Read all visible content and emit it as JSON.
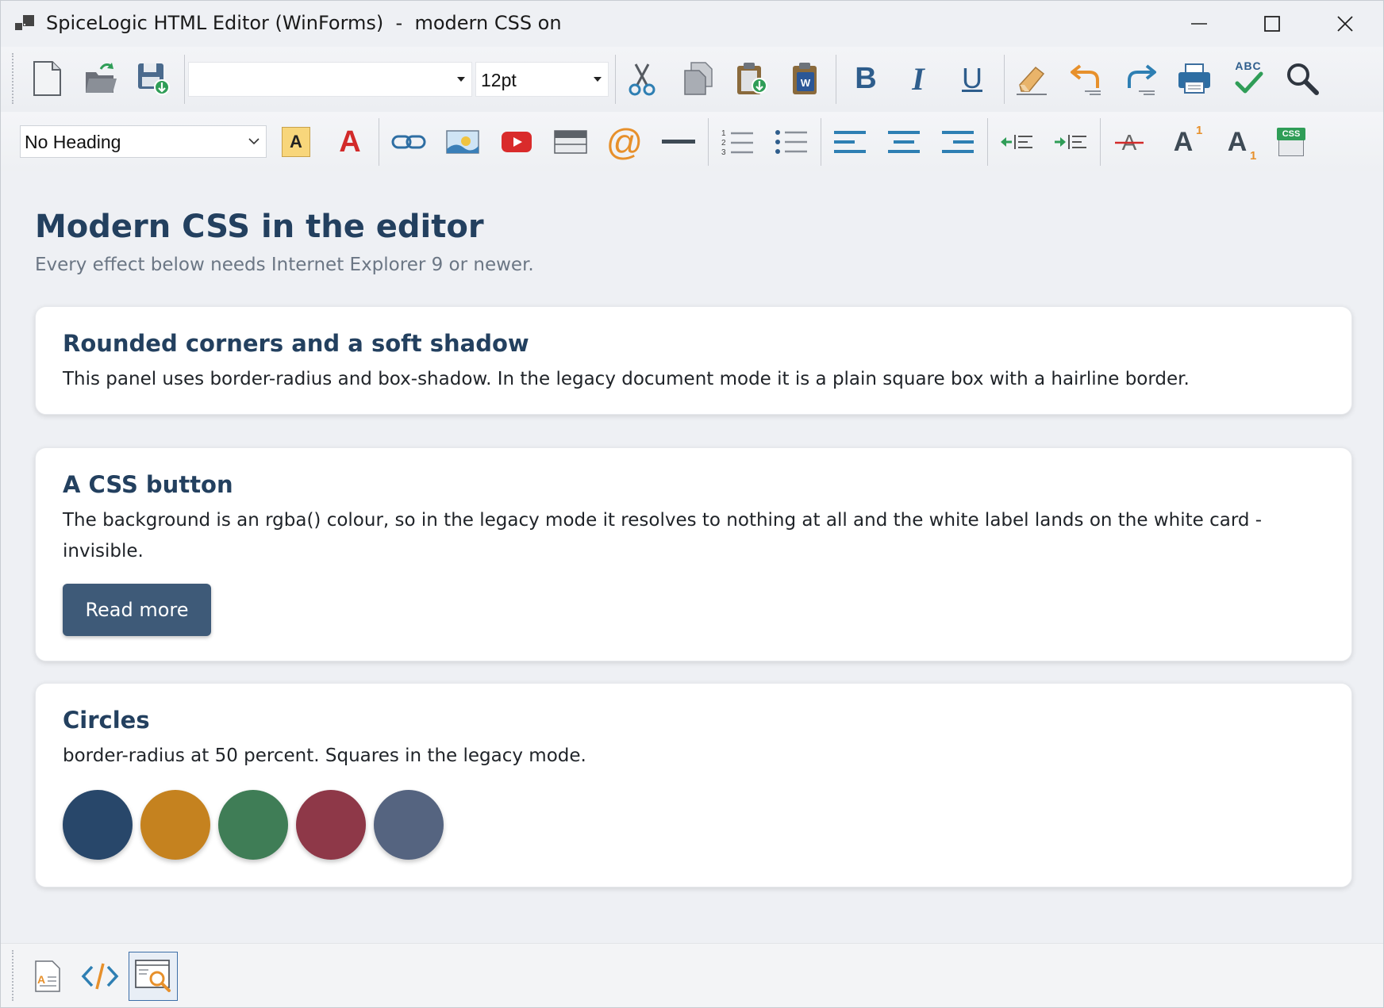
{
  "window": {
    "title": "SpiceLogic HTML Editor (WinForms)  -  modern CSS on",
    "controls": [
      "minimize-icon",
      "maximize-icon",
      "close-icon"
    ]
  },
  "toolbar1": {
    "font_name": "",
    "font_size": "12pt",
    "icons": [
      "new-document-icon",
      "open-folder-icon",
      "save-icon",
      "cut-icon",
      "copy-icon",
      "paste-icon",
      "paste-from-word-icon",
      "bold-icon",
      "italic-icon",
      "underline-icon",
      "clear-format-icon",
      "undo-icon",
      "redo-icon",
      "print-icon",
      "spell-check-icon",
      "find-icon"
    ],
    "bold_glyph": "B",
    "italic_glyph": "I",
    "underline_glyph": "U",
    "spellcheck_glyph": "ABC"
  },
  "toolbar2": {
    "heading_value": "No Heading",
    "icons": [
      "highlight-color-icon",
      "font-color-icon",
      "hyperlink-icon",
      "insert-image-icon",
      "insert-youtube-icon",
      "insert-table-icon",
      "insert-email-icon",
      "horizontal-rule-icon",
      "ordered-list-icon",
      "unordered-list-icon",
      "align-left-icon",
      "align-center-icon",
      "align-right-icon",
      "outdent-icon",
      "indent-icon",
      "strikethrough-icon",
      "superscript-icon",
      "subscript-icon",
      "css-icon"
    ],
    "highlight_glyph": "A",
    "fontcolor_glyph": "A",
    "email_glyph": "@",
    "super_glyph": "A",
    "super_num": "1",
    "sub_glyph": "A",
    "sub_num": "1",
    "css_glyph": "CSS",
    "list_nums": [
      "1",
      "2",
      "3"
    ]
  },
  "document": {
    "title": "Modern CSS in the editor",
    "subtitle": "Every effect below needs Internet Explorer 9 or newer.",
    "cards": [
      {
        "heading": "Rounded corners and a soft shadow",
        "text": "This panel uses border-radius and box-shadow. In the legacy document mode it is a plain square box with a hairline border."
      },
      {
        "heading": "A CSS button",
        "text": "The background is an rgba() colour, so in the legacy mode it resolves to nothing at all and the white label lands on the white card - invisible.",
        "button_label": "Read more"
      },
      {
        "heading": "Circles",
        "text": "border-radius at 50 percent. Squares in the legacy mode.",
        "circle_colors": [
          "#28476a",
          "#c5821f",
          "#3f7d56",
          "#8e3848",
          "#556480"
        ]
      }
    ]
  },
  "bottombar": {
    "views": [
      "design-view-icon",
      "source-view-icon",
      "preview-view-icon"
    ],
    "active_view": "preview-view-icon"
  },
  "colors": {
    "accent": "#23405f",
    "button_bg": "#3e5a78",
    "editor_bg": "#eef0f4"
  }
}
